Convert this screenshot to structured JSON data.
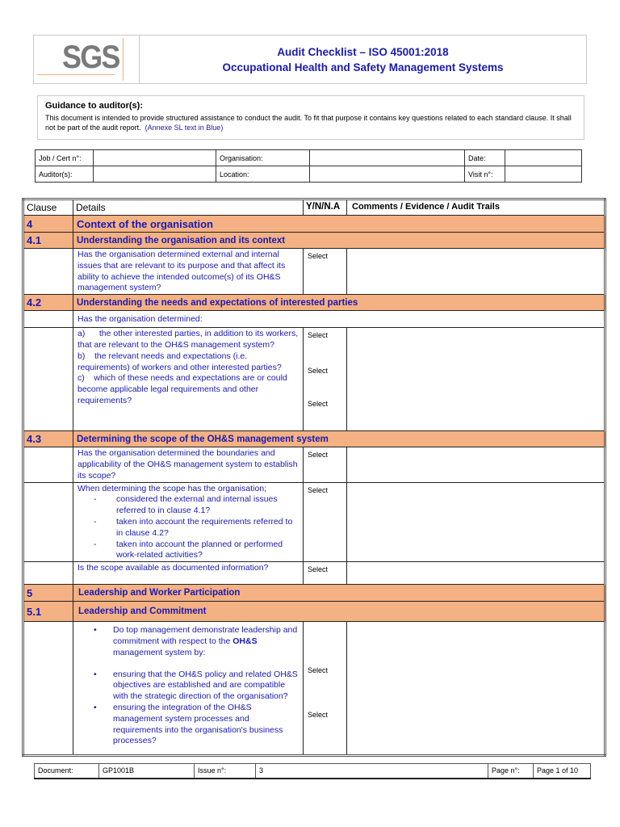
{
  "header": {
    "logo": "SGS",
    "title_line1": "Audit Checklist – ISO 45001:2018",
    "title_line2": "Occupational Health and Safety Management Systems"
  },
  "guidance": {
    "heading": "Guidance to auditor(s):",
    "text": "This document is intended to provide structured assistance to conduct the audit. To fit that purpose it contains key questions related to each standard clause. It shall not be part of the audit report.",
    "note": "(Annexe SL text in Blue)"
  },
  "info": {
    "job_label": "Job / Cert n°:",
    "job_value": "",
    "org_label": "Organisation:",
    "org_value": "",
    "date_label": "Date:",
    "date_value": "",
    "auditor_label": "Auditor(s):",
    "auditor_value": "",
    "location_label": "Location:",
    "location_value": "",
    "visit_label": "Visit n°:",
    "visit_value": ""
  },
  "columns": {
    "clause": "Clause",
    "details": "Details",
    "yn": "Y/N/N.A",
    "comments": "Comments / Evidence / Audit Trails"
  },
  "select_label": "Select",
  "sections": {
    "s4": {
      "num": "4",
      "title": "Context of the organisation"
    },
    "s41": {
      "num": "4.1",
      "title": "Understanding the organisation and its context"
    },
    "s42": {
      "num": "4.2",
      "title": "Understanding the needs and expectations of interested parties"
    },
    "s43": {
      "num": "4.3",
      "title": "Determining the scope of the OH&S management system"
    },
    "s5": {
      "num": "5",
      "title": "Leadership and Worker Participation"
    },
    "s51": {
      "num": "5.1",
      "title": "Leadership and Commitment"
    }
  },
  "questions": {
    "q41": "Has the organisation determined external and internal issues that are relevant to its purpose and that affect its ability to achieve the intended outcome(s) of its OH&S management system?",
    "q42_intro": "Has the organisation determined:",
    "q42_a": "a)      the other interested parties, in addition to its workers, that are relevant to the OH&S management system?",
    "q42_b": "b)    the relevant needs and expectations (i.e. requirements) of workers and other interested parties?",
    "q42_c": "c)    which of these needs and expectations are or could become applicable legal requirements and other requirements?",
    "q43_1": "Has the organisation determined the boundaries and applicability of the OH&S management system to establish its scope?",
    "q43_2_intro": "When determining the scope has the organisation;",
    "q43_2_items": [
      "considered the external and internal issues referred to in clause 4.1?",
      "taken into account the requirements referred to in clause 4.2?",
      "taken into account the planned or performed work-related activities?"
    ],
    "q43_3": "Is the scope available as documented information?",
    "q51_intro_pre": "Do top management demonstrate leadership and commitment with respect to the ",
    "q51_intro_bold": "OH&S",
    "q51_intro_post": " management system by:",
    "q51_items": [
      "ensuring that the OH&S policy and related OH&S objectives are established and are compatible with the strategic direction of the organisation?",
      "ensuring the integration of the OH&S management system processes and requirements into the organisation's business processes?"
    ]
  },
  "footer": {
    "doc_label": "Document:",
    "doc_value": "GP1001B",
    "issue_label": "Issue n°:",
    "issue_value": "3",
    "page_label": "Page n°:",
    "page_value": "Page 1 of 10"
  },
  "colors": {
    "section_fill": "#f4b183",
    "annex_blue": "#1a1ab0",
    "logo_grey": "#7a7a7a"
  }
}
